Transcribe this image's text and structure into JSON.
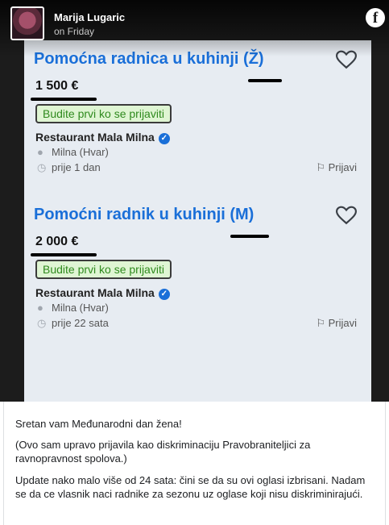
{
  "post": {
    "author": "Marija Lugaric",
    "time": "on Friday",
    "facebook_glyph": "f"
  },
  "jobs": [
    {
      "title": "Pomoćna radnica u kuhinji (Ž)",
      "price": "1 500 €",
      "badge": "Budite prvi ko se prijaviti",
      "company": "Restaurant Mala Milna",
      "location": "Milna (Hvar)",
      "posted": "prije 1 dan",
      "report": "Prijavi"
    },
    {
      "title": "Pomoćni radnik u kuhinji (M)",
      "price": "2 000 €",
      "badge": "Budite prvi ko se prijaviti",
      "company": "Restaurant Mala Milna",
      "location": "Milna (Hvar)",
      "posted": "prije 22 sata",
      "report": "Prijavi"
    }
  ],
  "caption": {
    "p1": "Sretan vam Međunarodni dan žena!",
    "p2": "(Ovo sam upravo prijavila kao diskriminaciju Pravobraniteljici za ravnopravnost spolova.)",
    "p3": "Update nako malo više od 24 sata: čini se da su ovi oglasi izbrisani. Nadam se da ce vlasnik naci radnike za sezonu uz oglase koji nisu diskriminirajući."
  },
  "icons": {
    "heart": "heart-icon",
    "location": "location-pin-icon",
    "clock": "clock-icon",
    "flag": "flag-icon",
    "verified": "verified-badge-icon",
    "facebook": "facebook-logo-icon"
  },
  "colors": {
    "title_blue": "#1a6fd8",
    "badge_green_text": "#2f8a1e",
    "badge_green_bg": "#dff5d3",
    "photo_bg": "#1c1c1c"
  }
}
